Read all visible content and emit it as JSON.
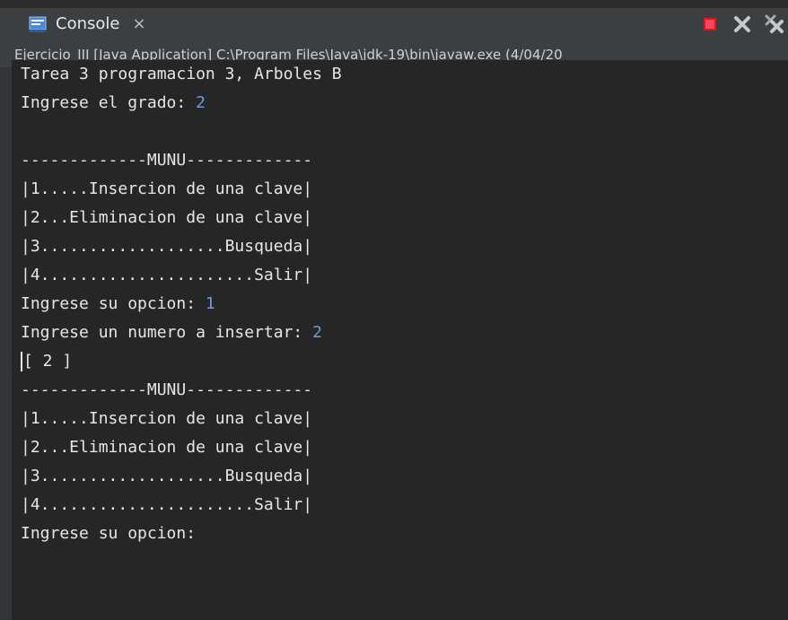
{
  "tab": {
    "label": "Console",
    "close": "×",
    "icon": "console-icon"
  },
  "toolbar": {
    "terminate_icon": "terminate-icon",
    "remove_launch_icon": "remove-launch-icon",
    "remove_all_icon": "remove-all-terminated-icon",
    "colors": {
      "terminate": "#e81123",
      "remove": "#c8c8c8"
    }
  },
  "subtitle": "Ejercicio_III [Java Application] C:\\Program Files\\Java\\jdk-19\\bin\\javaw.exe  (4/04/20",
  "console": {
    "lines": [
      {
        "text": "Tarea 3 programacion 3, Arboles B",
        "input": ""
      },
      {
        "text": "Ingrese el grado: ",
        "input": "2"
      },
      {
        "text": "",
        "input": ""
      },
      {
        "text": "-------------MUNU-------------",
        "input": ""
      },
      {
        "text": "|1.....Insercion de una clave|",
        "input": ""
      },
      {
        "text": "|2...Eliminacion de una clave|",
        "input": ""
      },
      {
        "text": "|3...................Busqueda|",
        "input": ""
      },
      {
        "text": "|4......................Salir|",
        "input": ""
      },
      {
        "text": "Ingrese su opcion: ",
        "input": "1"
      },
      {
        "text": "Ingrese un numero a insertar: ",
        "input": "2"
      },
      {
        "text": "[ 2 ]",
        "input": ""
      },
      {
        "text": "-------------MUNU-------------",
        "input": ""
      },
      {
        "text": "|1.....Insercion de una clave|",
        "input": ""
      },
      {
        "text": "|2...Eliminacion de una clave|",
        "input": ""
      },
      {
        "text": "|3...................Busqueda|",
        "input": ""
      },
      {
        "text": "|4......................Salir|",
        "input": ""
      },
      {
        "text": "Ingrese su opcion: ",
        "input": ""
      }
    ],
    "input_color": "#6b9dd8"
  }
}
